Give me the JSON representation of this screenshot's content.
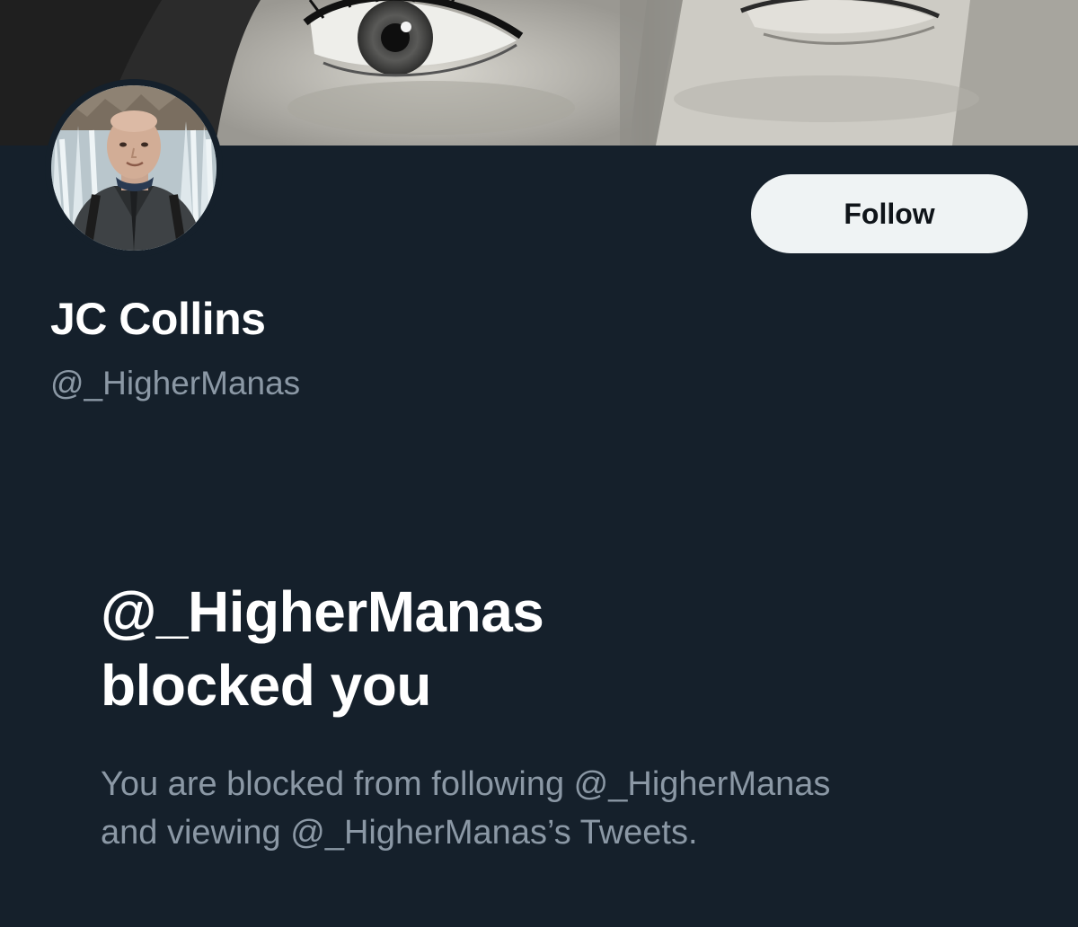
{
  "profile": {
    "display_name": "JC Collins",
    "handle": "@_HigherManas",
    "follow_label": "Follow"
  },
  "blocked_notice": {
    "title_line1": "@_HigherManas",
    "title_line2": "blocked you",
    "desc_line1": "You are blocked from following @_HigherManas",
    "desc_line2": "and viewing @_HigherManas’s Tweets."
  },
  "colors": {
    "background": "#15202b",
    "button_bg": "#eff3f4",
    "text_primary": "#ffffff",
    "text_secondary": "#8b98a5"
  }
}
